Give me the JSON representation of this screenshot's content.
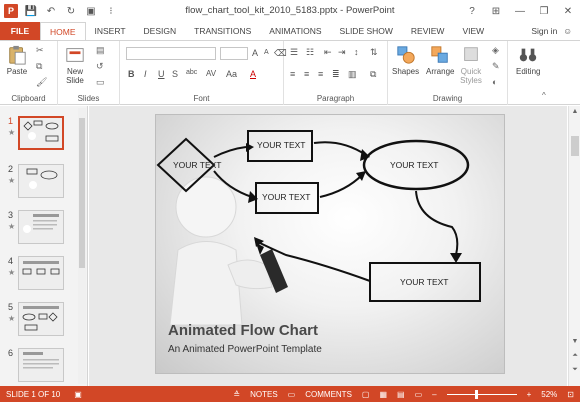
{
  "window": {
    "title": "flow_chart_tool_kit_2010_5183.pptx - PowerPoint",
    "help": "?",
    "minimize": "—",
    "restore": "❐",
    "close": "✕"
  },
  "qat": {
    "app_logo": "P",
    "save": "💾",
    "undo": "↶",
    "redo": "↻",
    "present": "▣",
    "more": "⁝"
  },
  "tabs": {
    "file": "FILE",
    "items": [
      "HOME",
      "INSERT",
      "DESIGN",
      "TRANSITIONS",
      "ANIMATIONS",
      "SLIDE SHOW",
      "REVIEW",
      "VIEW"
    ],
    "sign_in": "Sign in"
  },
  "ribbon": {
    "clipboard": {
      "label": "Clipboard",
      "paste": "Paste"
    },
    "slides": {
      "label": "Slides",
      "new_slide": "New",
      "new_slide_2": "Slide"
    },
    "font": {
      "label": "Font",
      "bold": "B",
      "italic": "I",
      "underline": "U",
      "strike": "S",
      "shadow": "abc",
      "spacing": "AV",
      "case": "Aa",
      "color": "A",
      "grow": "A",
      "shrink": "A"
    },
    "paragraph": {
      "label": "Paragraph"
    },
    "drawing": {
      "label": "Drawing",
      "shapes": "Shapes",
      "arrange": "Arrange",
      "quick_styles_1": "Quick",
      "quick_styles_2": "Styles"
    },
    "editing": {
      "label": "Editing"
    }
  },
  "slides_panel": {
    "numbers": [
      "1",
      "2",
      "3",
      "4",
      "5",
      "6"
    ],
    "star": "★"
  },
  "slide": {
    "title": "Animated Flow Chart",
    "subtitle": "An Animated PowerPoint Template",
    "boxes": [
      "YOUR TEXT",
      "YOUR TEXT",
      "YOUR TEXT",
      "YOUR TEXT",
      "YOUR TEXT"
    ]
  },
  "status": {
    "slide_counter": "SLIDE 1 OF 10",
    "notes": "NOTES",
    "comments": "COMMENTS",
    "zoom": "52%",
    "minus": "–",
    "plus": "+"
  }
}
